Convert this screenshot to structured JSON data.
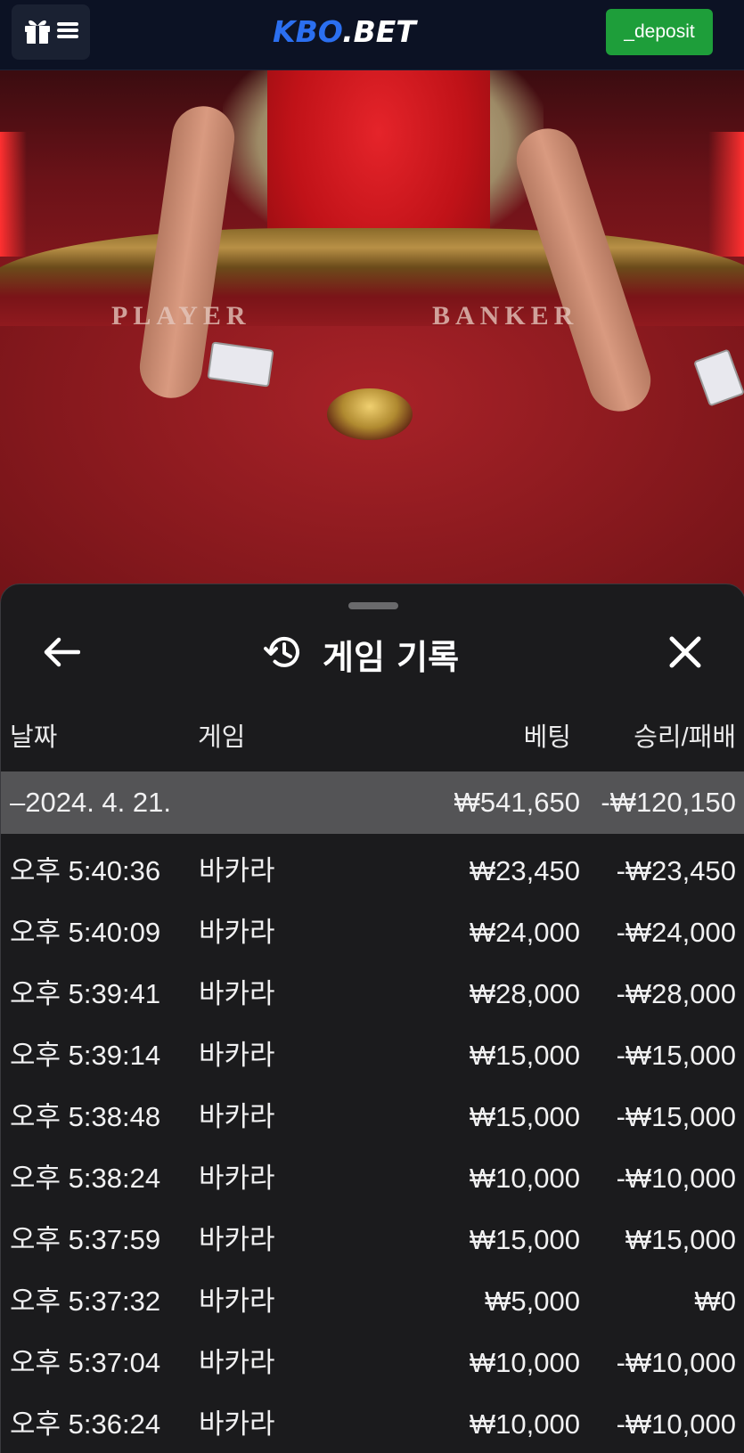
{
  "header": {
    "logo_blue": "KBO",
    "logo_white": ".BET",
    "deposit_label": "_deposit"
  },
  "video": {
    "player_label": "PLAYER",
    "banker_label": "BANKER"
  },
  "sheet": {
    "title": "게임 기록",
    "columns": {
      "date": "날짜",
      "game": "게임",
      "bet": "베팅",
      "result": "승리/패배"
    },
    "summary": {
      "date": "–2024. 4. 21.",
      "bet": "₩541,650",
      "result": "-₩120,150"
    },
    "rows": [
      {
        "time": "오후 5:40:36",
        "game": "바카라",
        "bet": "₩23,450",
        "result": "-₩23,450"
      },
      {
        "time": "오후 5:40:09",
        "game": "바카라",
        "bet": "₩24,000",
        "result": "-₩24,000"
      },
      {
        "time": "오후 5:39:41",
        "game": "바카라",
        "bet": "₩28,000",
        "result": "-₩28,000"
      },
      {
        "time": "오후 5:39:14",
        "game": "바카라",
        "bet": "₩15,000",
        "result": "-₩15,000"
      },
      {
        "time": "오후 5:38:48",
        "game": "바카라",
        "bet": "₩15,000",
        "result": "-₩15,000"
      },
      {
        "time": "오후 5:38:24",
        "game": "바카라",
        "bet": "₩10,000",
        "result": "-₩10,000"
      },
      {
        "time": "오후 5:37:59",
        "game": "바카라",
        "bet": "₩15,000",
        "result": "₩15,000"
      },
      {
        "time": "오후 5:37:32",
        "game": "바카라",
        "bet": "₩5,000",
        "result": "₩0"
      },
      {
        "time": "오후 5:37:04",
        "game": "바카라",
        "bet": "₩10,000",
        "result": "-₩10,000"
      },
      {
        "time": "오후 5:36:24",
        "game": "바카라",
        "bet": "₩10,000",
        "result": "-₩10,000"
      }
    ]
  },
  "colors": {
    "deposit": "#1e9e3a",
    "logo_accent": "#2b6ff0",
    "sheet_bg": "#1b1b1d",
    "summary_bg": "#545456"
  },
  "icons": {
    "menu": "gift-menu-icon",
    "back": "arrow-left-icon",
    "history": "history-icon",
    "close": "close-icon"
  }
}
